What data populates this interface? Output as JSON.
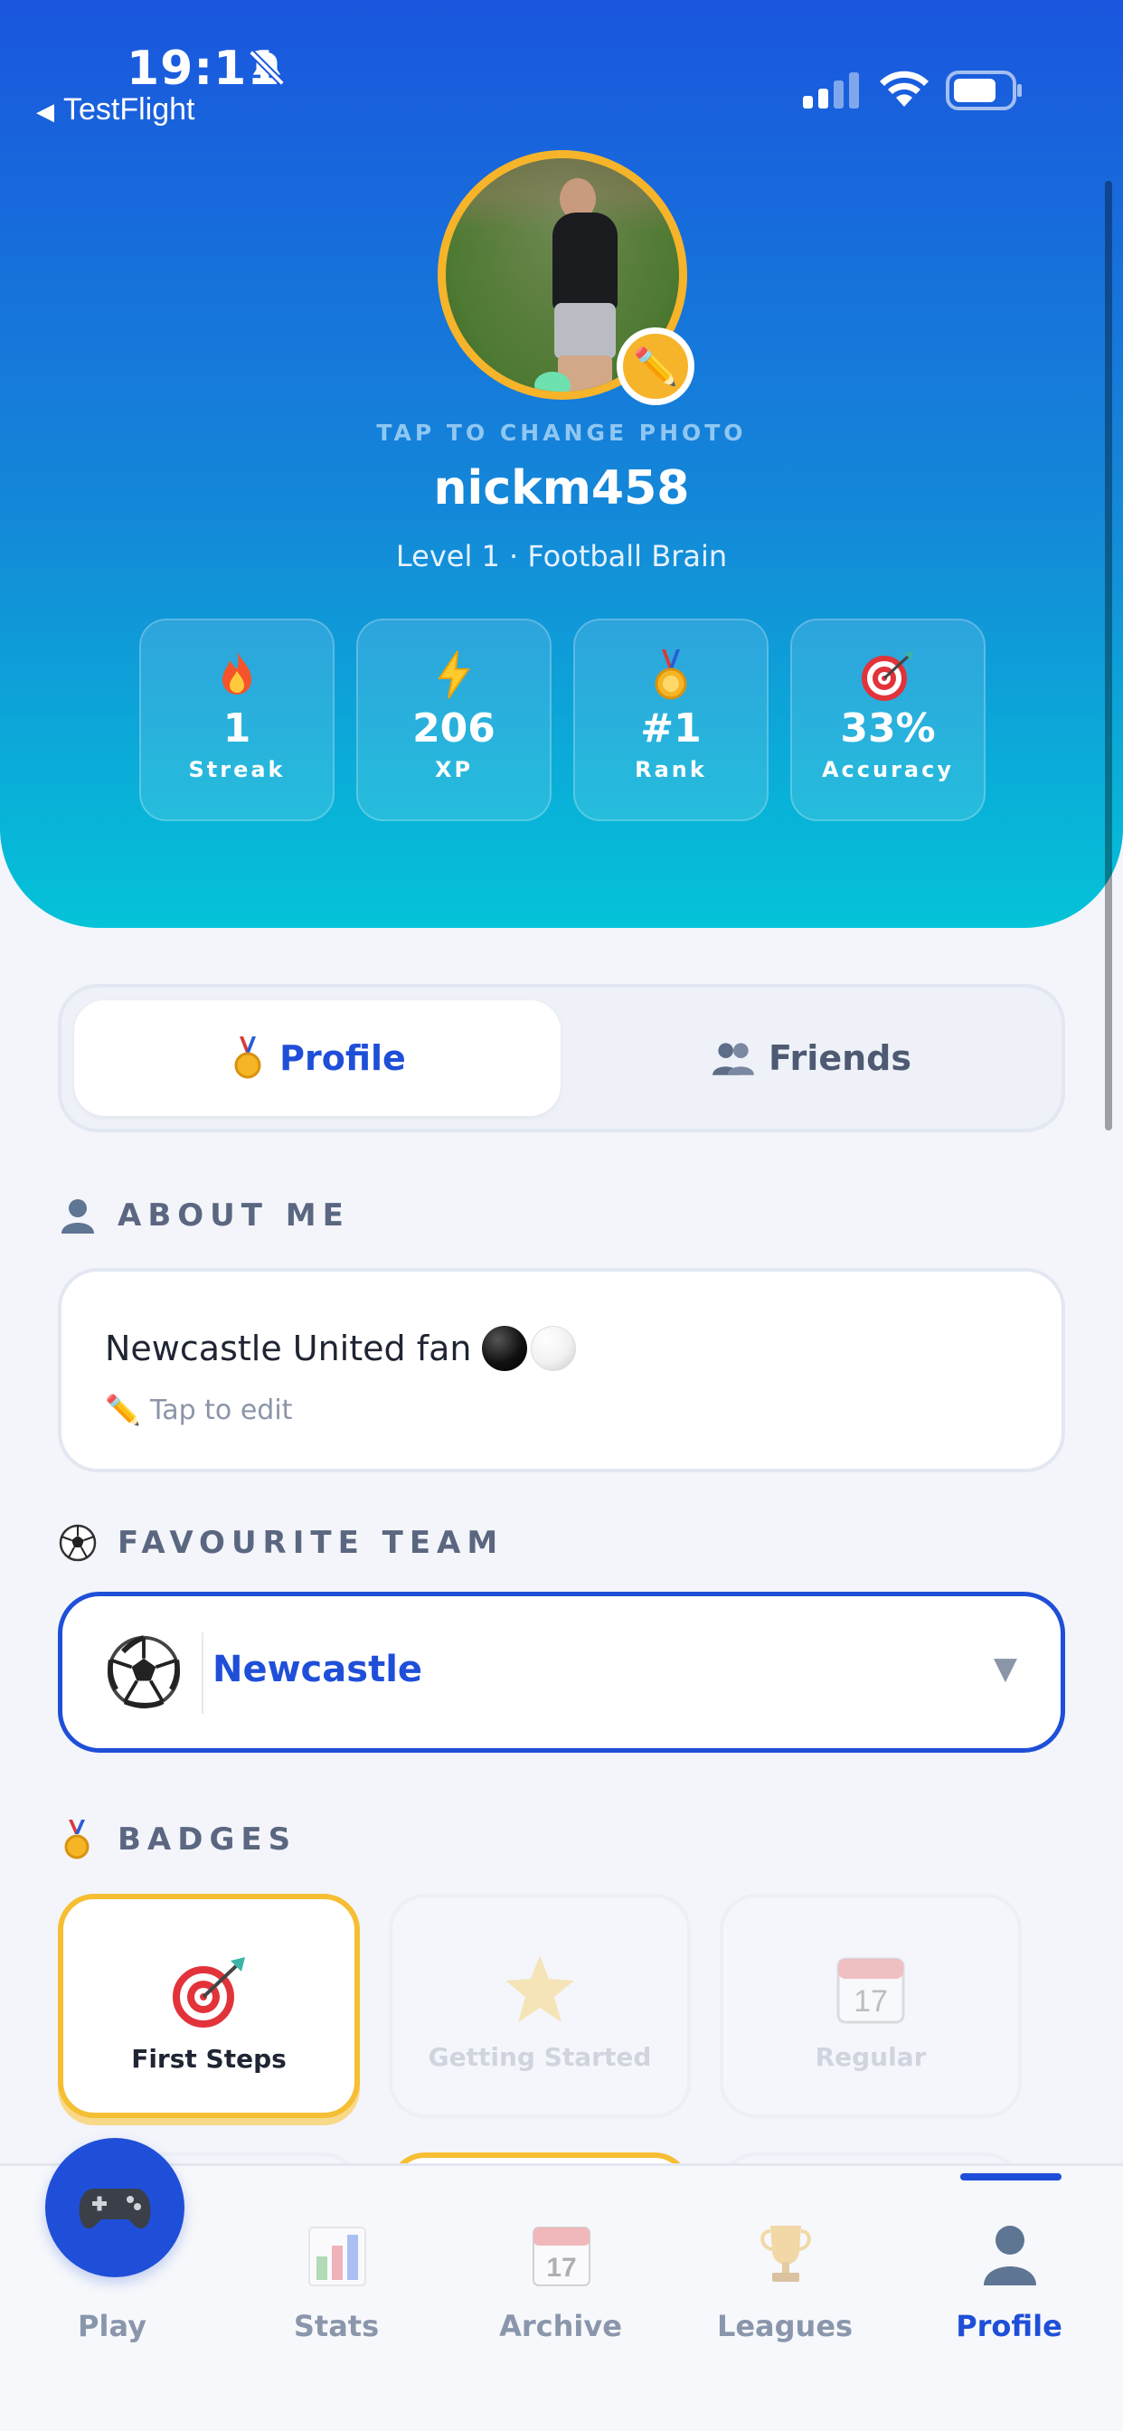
{
  "status_bar": {
    "time": "19:11",
    "back_app": "TestFlight"
  },
  "profile": {
    "tap_change_photo": "TAP TO CHANGE PHOTO",
    "username": "nickm458",
    "level_line": "Level 1 · Football Brain"
  },
  "stats": [
    {
      "icon": "fire-icon",
      "value": "1",
      "label": "Streak"
    },
    {
      "icon": "lightning-icon",
      "value": "206",
      "label": "XP"
    },
    {
      "icon": "medal-icon",
      "value": "#1",
      "label": "Rank"
    },
    {
      "icon": "target-icon",
      "value": "33%",
      "label": "Accuracy"
    }
  ],
  "segmented": {
    "profile_label": "Profile",
    "friends_label": "Friends",
    "active": "Profile"
  },
  "about": {
    "heading": "ABOUT ME",
    "text": "Newcastle United fan",
    "hint": "Tap to edit"
  },
  "favourite_team": {
    "heading": "FAVOURITE TEAM",
    "selected": "Newcastle"
  },
  "badges": {
    "heading": "BADGES",
    "items": [
      {
        "name": "First Steps",
        "icon": "target-icon",
        "earned": true
      },
      {
        "name": "Getting Started",
        "icon": "star-icon",
        "earned": false
      },
      {
        "name": "Regular",
        "icon": "calendar-icon",
        "earned": false
      }
    ]
  },
  "tabbar": {
    "items": [
      {
        "label": "Play",
        "icon": "gamepad-icon"
      },
      {
        "label": "Stats",
        "icon": "bar-chart-icon"
      },
      {
        "label": "Archive",
        "icon": "calendar-icon"
      },
      {
        "label": "Leagues",
        "icon": "trophy-icon"
      },
      {
        "label": "Profile",
        "icon": "person-icon"
      }
    ],
    "active": "Profile"
  },
  "colors": {
    "accent": "#1f4fd8",
    "gold": "#f6b42a",
    "header_top": "#1a56de",
    "header_bottom": "#04c3d8"
  }
}
